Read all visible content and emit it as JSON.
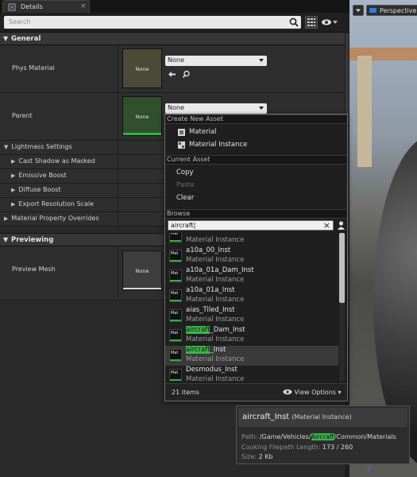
{
  "tab": {
    "title": "Details"
  },
  "search": {
    "placeholder": "Search"
  },
  "viewport": {
    "perspective_label": "Perspective",
    "axis_label": "Z"
  },
  "general": {
    "header": "General",
    "phys_material": {
      "label": "Phys Material",
      "thumb_label": "None",
      "combo_value": "None"
    },
    "parent": {
      "label": "Parent",
      "thumb_label": "None",
      "combo_value": "None"
    },
    "lightmass_settings": "Lightmass Settings",
    "cast_shadow": "Cast Shadow as Masked",
    "emissive_boost": "Emissive Boost",
    "diffuse_boost": "Diffuse Boost",
    "export_resolution_scale": "Export Resolution Scale",
    "material_property_overrides": "Material Property Overrides"
  },
  "previewing": {
    "header": "Previewing",
    "preview_mesh": {
      "label": "Preview Mesh",
      "thumb_label": "None"
    }
  },
  "dropdown": {
    "create_header": "Create New Asset",
    "create_items": [
      "Material",
      "Material Instance"
    ],
    "current_header": "Current Asset",
    "copy": "Copy",
    "paste": "Paste",
    "clear": "Clear",
    "browse_header": "Browse",
    "search_value": "aircraft|",
    "thumb_text": "Mat",
    "assets": [
      {
        "pre": "",
        "match": "",
        "post": "a",
        "type": "Material Instance"
      },
      {
        "pre": "",
        "match": "",
        "post": "a10a_00_Inst",
        "type": "Material Instance"
      },
      {
        "pre": "",
        "match": "",
        "post": "a10a_01a_Dam_Inst",
        "type": "Material Instance"
      },
      {
        "pre": "",
        "match": "",
        "post": "a10a_01a_Inst",
        "type": "Material Instance"
      },
      {
        "pre": "",
        "match": "",
        "post": "aias_Tiled_Inst",
        "type": "Material Instance"
      },
      {
        "pre": "",
        "match": "aircraft",
        "post": "_Dam_Inst",
        "type": "Material Instance"
      },
      {
        "pre": "",
        "match": "aircraft",
        "post": "_Inst",
        "type": "Material Instance",
        "selected": true
      },
      {
        "pre": "",
        "match": "",
        "post": "Desmodus_Inst",
        "type": "Material Instance"
      }
    ],
    "item_count": "21 items",
    "view_options": "View Options"
  },
  "tooltip": {
    "title": "aircraft_Inst",
    "subtitle": "(Material Instance)",
    "path_label": "Path:",
    "path_pre": "/Game/Vehicles/",
    "path_match": "Aircraft",
    "path_post": "/Common/Materials",
    "cooking_label": "Cooking Filepath Length:",
    "cooking_value": "173 / 260",
    "size_label": "Size:",
    "size_value": "2 Kb"
  },
  "colors": {
    "highlight": "#3bb44a",
    "thumb_green": "#2bb63a",
    "accent_blue": "#2b7de0"
  }
}
